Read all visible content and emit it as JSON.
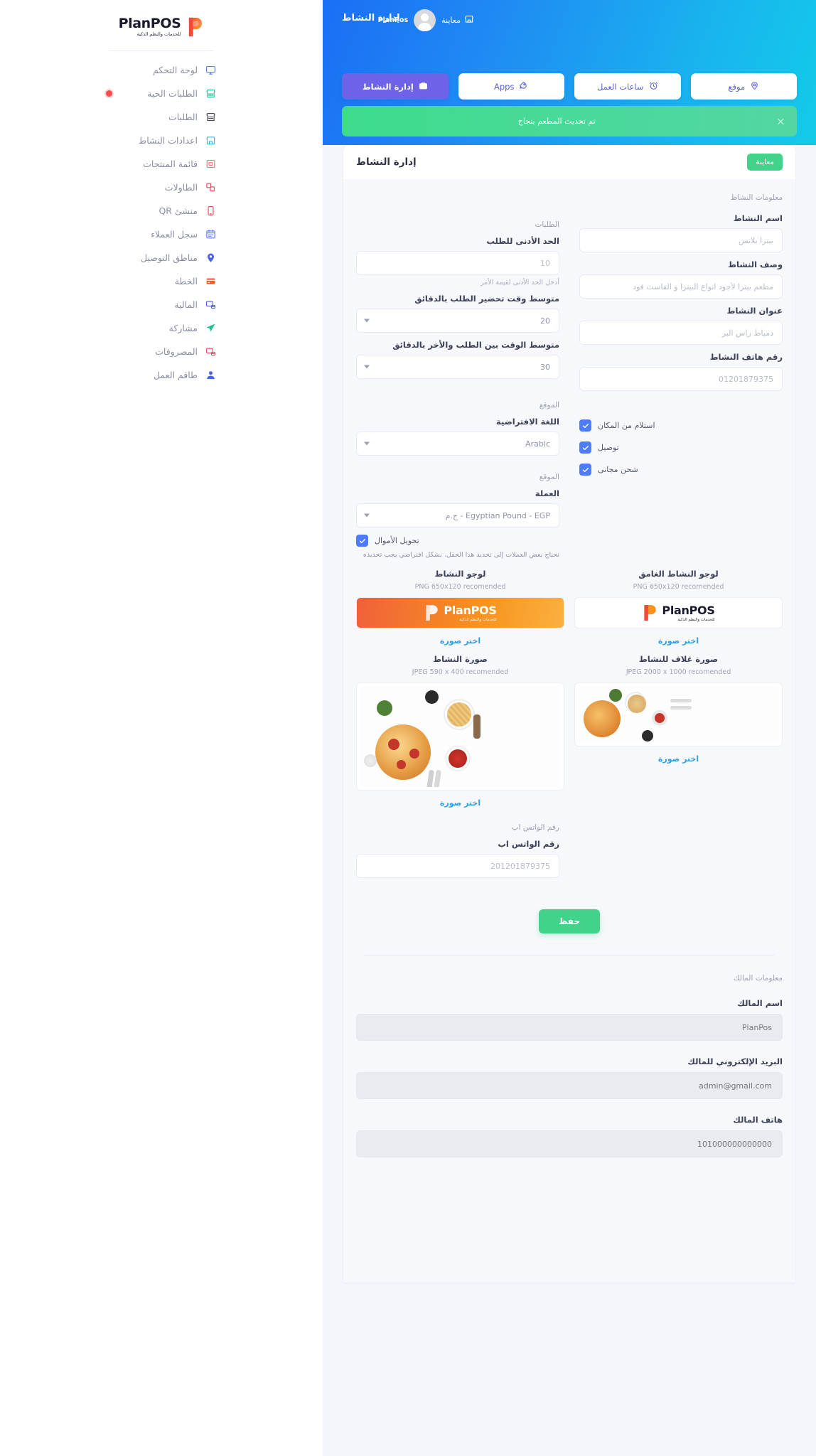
{
  "brand": {
    "name": "PlanPOS",
    "tagline": "للخدمات والنظم الذكية"
  },
  "sidebar": {
    "items": [
      {
        "label": "لوحة التحكم",
        "icon": "monitor-icon",
        "badge": false
      },
      {
        "label": "الطلبات الحية",
        "icon": "store-green-icon",
        "badge": true
      },
      {
        "label": "الطلبات",
        "icon": "orders-icon",
        "badge": false
      },
      {
        "label": "اعدادات النشاط",
        "icon": "shop-settings-icon",
        "badge": false
      },
      {
        "label": "قائمة المنتجات",
        "icon": "menu-list-icon",
        "badge": false
      },
      {
        "label": "الطاولات",
        "icon": "tables-icon",
        "badge": false
      },
      {
        "label": "منشئ QR",
        "icon": "qr-builder-icon",
        "badge": false
      },
      {
        "label": "سجل العملاء",
        "icon": "customers-log-icon",
        "badge": false
      },
      {
        "label": "مناطق التوصيل",
        "icon": "delivery-pin-icon",
        "badge": false
      },
      {
        "label": "الخطة",
        "icon": "plan-card-icon",
        "badge": false
      },
      {
        "label": "المالية",
        "icon": "finance-icon",
        "badge": false
      },
      {
        "label": "مشاركة",
        "icon": "share-icon",
        "badge": false
      },
      {
        "label": "المصروفات",
        "icon": "expenses-icon",
        "badge": false
      },
      {
        "label": "طاقم العمل",
        "icon": "staff-icon",
        "badge": false
      }
    ]
  },
  "hero": {
    "title": "إدارة النشاط",
    "user_name": "PlanPos",
    "preview_label": "معاينة",
    "tabs": [
      {
        "label": "إدارة النشاط",
        "icon": "business-icon",
        "active": true
      },
      {
        "label": "Apps",
        "icon": "rocket-icon",
        "active": false
      },
      {
        "label": "ساعات العمل",
        "icon": "clock-icon",
        "active": false
      },
      {
        "label": "موقع",
        "icon": "location-icon",
        "active": false
      }
    ],
    "alert": {
      "message": "تم تحديث المطعم بنجاح",
      "close_label": "×"
    }
  },
  "card": {
    "title": "إدارة النشاط",
    "preview_button": "معاينة",
    "section_business_info": "معلومات النشاط",
    "section_orders": "الطلبات",
    "section_location": "الموقع",
    "section_location_2": "الموقع",
    "section_whatsapp": "رقم الواتس اب",
    "section_owner_info": "معلومات المالك"
  },
  "form": {
    "business_name": {
      "label": "اسم النشاط",
      "value": "بيتزا بلانس"
    },
    "business_desc": {
      "label": "وصف النشاط",
      "value": "مطعم بيتزا لأجود انواع البيتزا و الفاست فود"
    },
    "business_address": {
      "label": "عنوان النشاط",
      "value": "دمياط راس البر"
    },
    "business_phone": {
      "label": "رقم هاتف النشاط",
      "value": "01201879375"
    },
    "min_order": {
      "label": "الحد الأدنى للطلب",
      "value": "10",
      "hint": "أدخل الحد الأدنى لقيمة الأمر"
    },
    "avg_prep_time": {
      "label": "متوسط وقت تحضير الطلب بالدقائق",
      "value": "20"
    },
    "avg_between_time": {
      "label": "متوسط الوقت بين الطلب والأخر بالدقائق",
      "value": "30"
    },
    "default_language": {
      "label": "اللغة الافتراضية",
      "value": "Arabic"
    },
    "currency": {
      "label": "العملة",
      "value": "Egyptian Pound - EGP - ج.م"
    },
    "whatsapp": {
      "label": "رقم الواتس اب",
      "value": "201201879375"
    },
    "checkboxes": [
      {
        "label": "استلام من المكان",
        "checked": true
      },
      {
        "label": "توصيل",
        "checked": true
      },
      {
        "label": "شحن مجانى",
        "checked": true
      }
    ],
    "money_convert": {
      "label": "تحويل الأموال",
      "checked": true,
      "note": "تحتاج بعض العملات إلى تحديد هذا الحقل. بشكل افتراضي يجب تحديده"
    }
  },
  "uploads": [
    {
      "title": "لوجو النشاط",
      "requirement": "PNG 650x120 recomended",
      "link": "اختر صورة",
      "kind": "logo-light"
    },
    {
      "title": "لوجو النشاط الغامق",
      "requirement": "PNG 650x120 recomended",
      "link": "اختر صورة",
      "kind": "logo-dark"
    },
    {
      "title": "صورة النشاط",
      "requirement": "JPEG 590 x 400 recomended",
      "link": "اختر صورة",
      "kind": "photo-tall"
    },
    {
      "title": "صورة غلاف للنشاط",
      "requirement": "JPEG 2000 x 1000 recomended",
      "link": "اختر صورة",
      "kind": "photo-cover"
    }
  ],
  "save_button": "حفظ",
  "owner": {
    "name": {
      "label": "اسم المالك",
      "value": "PlanPos"
    },
    "email": {
      "label": "البريد الإلكتروني للمالك",
      "value": "admin@gmail.com"
    },
    "phone": {
      "label": "هاتف المالك",
      "value": "101000000000000"
    }
  },
  "colors": {
    "hero_start": "#1b6ef5",
    "hero_end": "#12cbe8",
    "accent_purple": "#6c63e8",
    "success_green": "#3fd48a",
    "link_blue": "#2e9fe0",
    "checkbox_blue": "#4d7cfe",
    "live_red": "#fd4a4a"
  }
}
